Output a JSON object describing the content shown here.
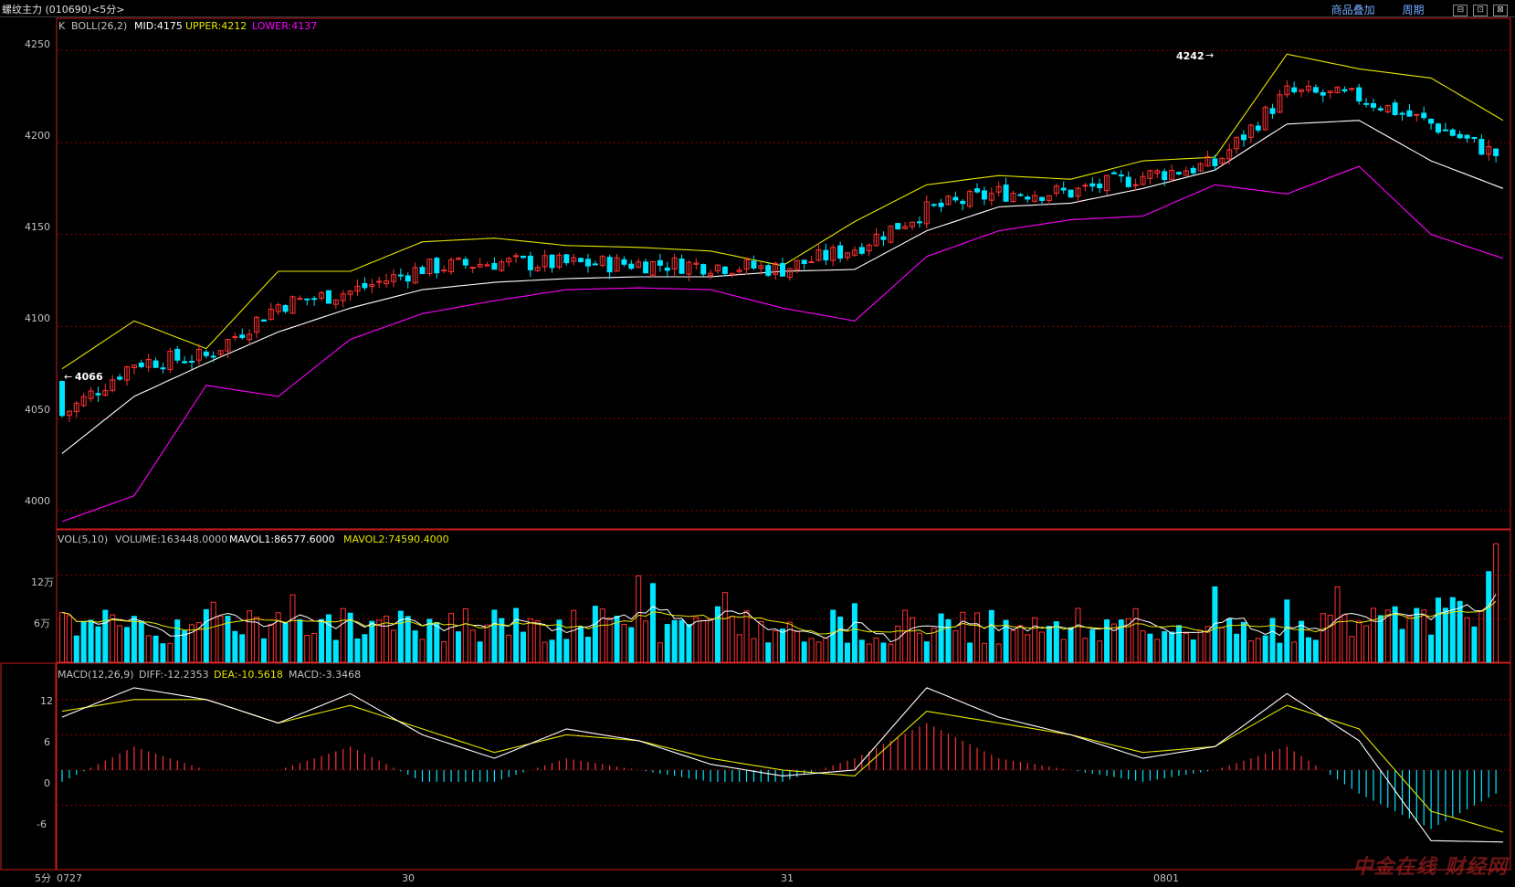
{
  "window": {
    "title": "螺纹主力 (010690)<5分>",
    "links": [
      "商品叠加",
      "周期"
    ],
    "buttons": [
      "⊟",
      "⊡",
      "⊠"
    ]
  },
  "price_panel": {
    "indicator_prefix": "K",
    "indicator_name": "BOLL(26,2)",
    "mid": "MID:4175",
    "upper": "UPPER:4212",
    "lower": "LOWER:4137",
    "y_ticks": [
      "4250",
      "4200",
      "4150",
      "4100",
      "4050",
      "4000"
    ],
    "annotations": {
      "high": "4242",
      "low": "4066"
    }
  },
  "volume_panel": {
    "name": "VOL(5,10)",
    "volume": "VOLUME:163448.0000",
    "mavol1": "MAVOL1:86577.6000",
    "mavol2": "MAVOL2:74590.4000",
    "y_ticks": [
      "12万",
      "6万"
    ]
  },
  "macd_panel": {
    "name": "MACD(12,26,9)",
    "diff": "DIFF:-12.2353",
    "dea": "DEA:-10.5618",
    "macd": "MACD:-3.3468",
    "y_ticks": [
      "12",
      "6",
      "0",
      "-6"
    ]
  },
  "x_axis": {
    "period": "5分",
    "labels": [
      "0727",
      "30",
      "31",
      "0801"
    ]
  },
  "colors": {
    "background": "#000000",
    "up": "#ff3232",
    "down": "#00e5ff",
    "mid_line": "#ffffff",
    "upper_line": "#e6e600",
    "lower_line": "#ff00ff",
    "grid": "#8b0000",
    "frame": "#c81e1e",
    "link": "#6fa8ff"
  },
  "watermark": "中金在线 财经网",
  "chart_data": [
    {
      "type": "candlestick",
      "title": "K BOLL(26,2)",
      "ylim": [
        3990,
        4265
      ],
      "series": [
        {
          "name": "BOLL MID",
          "points": [
            [
              0,
              4031
            ],
            [
              0.05,
              4062
            ],
            [
              0.1,
              4080
            ],
            [
              0.15,
              4097
            ],
            [
              0.2,
              4110
            ],
            [
              0.25,
              4120
            ],
            [
              0.3,
              4124
            ],
            [
              0.35,
              4126
            ],
            [
              0.4,
              4127
            ],
            [
              0.45,
              4127
            ],
            [
              0.5,
              4130
            ],
            [
              0.55,
              4131
            ],
            [
              0.6,
              4152
            ],
            [
              0.65,
              4165
            ],
            [
              0.7,
              4167
            ],
            [
              0.75,
              4175
            ],
            [
              0.8,
              4185
            ],
            [
              0.85,
              4210
            ],
            [
              0.9,
              4212
            ],
            [
              0.95,
              4190
            ],
            [
              1,
              4175
            ]
          ]
        },
        {
          "name": "BOLL UPPER",
          "points": [
            [
              0,
              4077
            ],
            [
              0.05,
              4103
            ],
            [
              0.1,
              4088
            ],
            [
              0.15,
              4130
            ],
            [
              0.2,
              4130
            ],
            [
              0.25,
              4146
            ],
            [
              0.3,
              4148
            ],
            [
              0.35,
              4144
            ],
            [
              0.4,
              4143
            ],
            [
              0.45,
              4141
            ],
            [
              0.5,
              4133
            ],
            [
              0.55,
              4157
            ],
            [
              0.6,
              4177
            ],
            [
              0.65,
              4182
            ],
            [
              0.7,
              4180
            ],
            [
              0.75,
              4190
            ],
            [
              0.8,
              4192
            ],
            [
              0.85,
              4248
            ],
            [
              0.9,
              4240
            ],
            [
              0.95,
              4235
            ],
            [
              1,
              4212
            ]
          ]
        },
        {
          "name": "BOLL LOWER",
          "points": [
            [
              0,
              3994
            ],
            [
              0.05,
              4008
            ],
            [
              0.1,
              4068
            ],
            [
              0.15,
              4062
            ],
            [
              0.2,
              4093
            ],
            [
              0.25,
              4107
            ],
            [
              0.3,
              4114
            ],
            [
              0.35,
              4120
            ],
            [
              0.4,
              4121
            ],
            [
              0.45,
              4120
            ],
            [
              0.5,
              4110
            ],
            [
              0.55,
              4103
            ],
            [
              0.6,
              4138
            ],
            [
              0.65,
              4152
            ],
            [
              0.7,
              4158
            ],
            [
              0.75,
              4160
            ],
            [
              0.8,
              4177
            ],
            [
              0.85,
              4172
            ],
            [
              0.9,
              4187
            ],
            [
              0.95,
              4150
            ],
            [
              1,
              4137
            ]
          ]
        }
      ],
      "annotations": [
        {
          "label": "4242",
          "value": 4242
        },
        {
          "label": "4066",
          "value": 4066
        }
      ]
    },
    {
      "type": "bar",
      "title": "VOL(5,10)",
      "ylim": [
        0,
        165000
      ],
      "last_volume": 163448,
      "mavol1_last": 86577.6,
      "mavol2_last": 74590.4
    },
    {
      "type": "bar",
      "title": "MACD(12,26,9)",
      "ylim": [
        -16,
        16
      ],
      "series": [
        {
          "name": "DIFF",
          "points": [
            [
              0,
              9
            ],
            [
              0.05,
              14
            ],
            [
              0.1,
              12
            ],
            [
              0.15,
              8
            ],
            [
              0.2,
              13
            ],
            [
              0.25,
              6
            ],
            [
              0.3,
              2
            ],
            [
              0.35,
              7
            ],
            [
              0.4,
              5
            ],
            [
              0.45,
              1
            ],
            [
              0.5,
              -1
            ],
            [
              0.55,
              0
            ],
            [
              0.6,
              14
            ],
            [
              0.65,
              9
            ],
            [
              0.7,
              6
            ],
            [
              0.75,
              2
            ],
            [
              0.8,
              4
            ],
            [
              0.85,
              13
            ],
            [
              0.9,
              5
            ],
            [
              0.95,
              -12
            ],
            [
              1,
              -12.2353
            ]
          ]
        },
        {
          "name": "DEA",
          "points": [
            [
              0,
              10
            ],
            [
              0.05,
              12
            ],
            [
              0.1,
              12
            ],
            [
              0.15,
              8
            ],
            [
              0.2,
              11
            ],
            [
              0.25,
              7
            ],
            [
              0.3,
              3
            ],
            [
              0.35,
              6
            ],
            [
              0.4,
              5
            ],
            [
              0.45,
              2
            ],
            [
              0.5,
              0
            ],
            [
              0.55,
              -1
            ],
            [
              0.6,
              10
            ],
            [
              0.65,
              8
            ],
            [
              0.7,
              6
            ],
            [
              0.75,
              3
            ],
            [
              0.8,
              4
            ],
            [
              0.85,
              11
            ],
            [
              0.9,
              7
            ],
            [
              0.95,
              -7
            ],
            [
              1,
              -10.5618
            ]
          ]
        }
      ]
    }
  ]
}
